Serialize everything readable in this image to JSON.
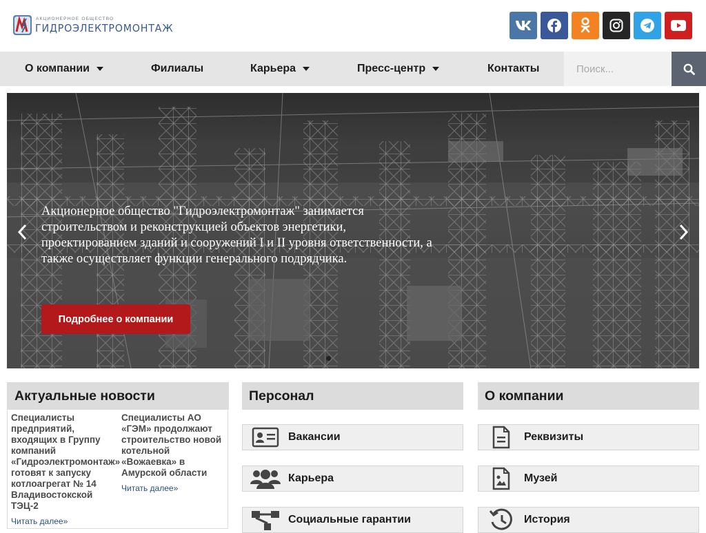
{
  "header": {
    "logo_small": "Акционерное общество",
    "logo_big": "ГИДРОЭЛЕКТРОМОНТАЖ",
    "socials": [
      {
        "icon": "vk-icon",
        "color": "#4a76a8"
      },
      {
        "icon": "facebook-icon",
        "color": "#3b5998"
      },
      {
        "icon": "odnoklassniki-icon",
        "color": "#f58220"
      },
      {
        "icon": "instagram-icon",
        "color": "#262626"
      },
      {
        "icon": "telegram-icon",
        "color": "#30a3e6"
      },
      {
        "icon": "youtube-icon",
        "color": "#cd201f"
      }
    ]
  },
  "nav": {
    "items": [
      "О компании",
      "Филиалы",
      "Карьера",
      "Пресс-центр",
      "Контакты"
    ],
    "search_placeholder": "Поиск..."
  },
  "hero": {
    "text": "Акционерное общество \"Гидроэлектромонтаж\" занимается строительством и реконструкцией объектов энергетики, проектированием зданий и сооружений I и II уровня ответственности, а также осуществляет функции генерального подрядчика.",
    "button": "Подробнее о компании"
  },
  "news": {
    "title": "Актуальные новости",
    "items": [
      {
        "title": "Специалисты предприятий, входящих в Группу компаний «Гидроэлектромонтаж» готовят к запуску котлоагрегат № 14 Владивостокской ТЭЦ-2",
        "more": "Читать далее»"
      },
      {
        "title": "Специалисты АО «ГЭМ» продолжают строительство новой котельной «Вожаевка» в Амурской области",
        "more": "Читать далее»"
      }
    ]
  },
  "personnel": {
    "title": "Персонал",
    "items": [
      {
        "label": "Вакансии",
        "icon": "id-card-icon"
      },
      {
        "label": "Карьера",
        "icon": "users-icon"
      },
      {
        "label": "Социальные гарантии",
        "icon": "network-icon"
      }
    ]
  },
  "about": {
    "title": "О компании",
    "items": [
      {
        "label": "Реквизиты",
        "icon": "document-icon"
      },
      {
        "label": "Музей",
        "icon": "image-file-icon"
      },
      {
        "label": "История",
        "icon": "history-icon"
      }
    ]
  }
}
